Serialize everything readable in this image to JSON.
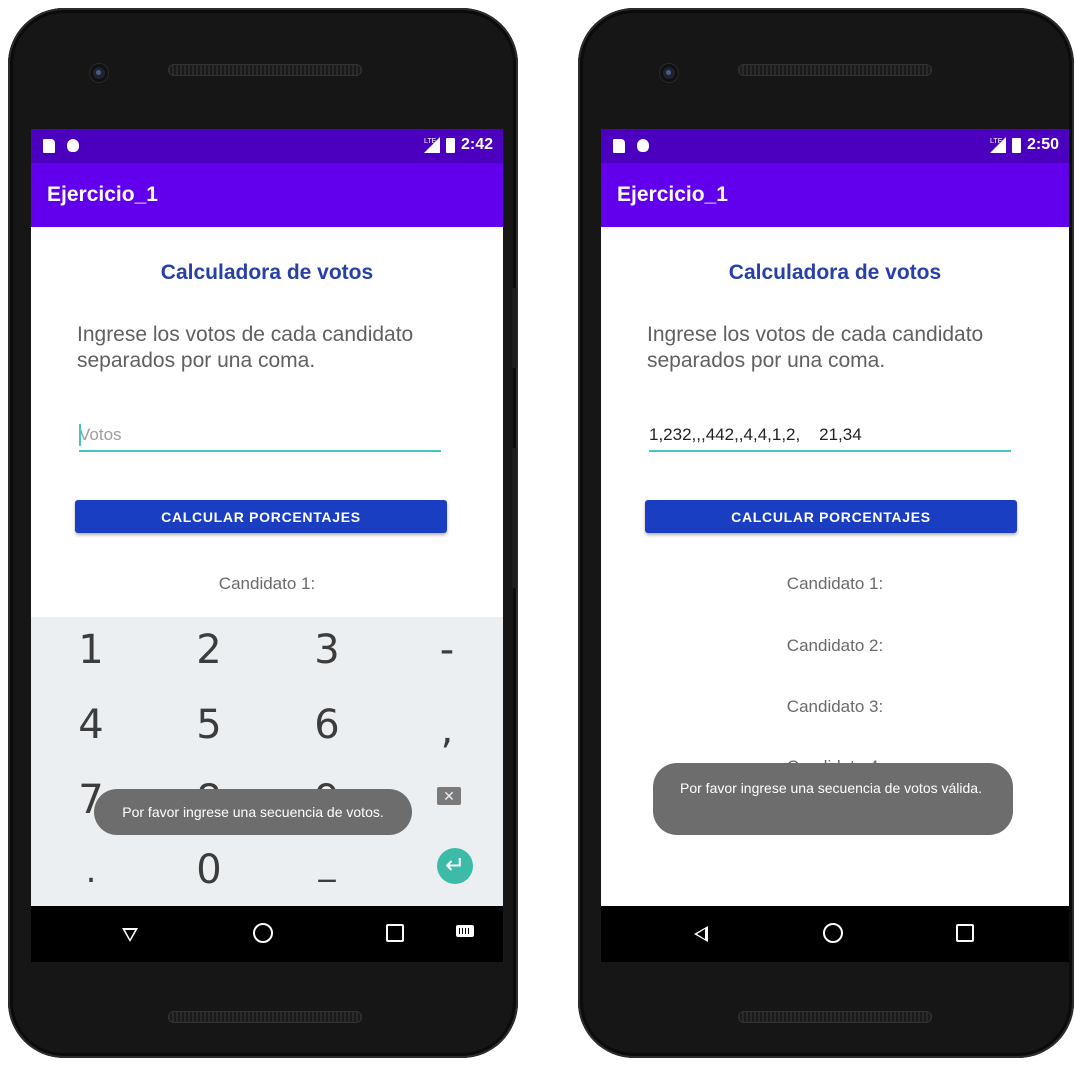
{
  "screens": [
    {
      "status_time": "2:42",
      "status_lte": "LTE",
      "app_title": "Ejercicio_1",
      "heading": "Calculadora de votos",
      "instruction": "Ingrese los votos de cada candidato separados por una coma.",
      "votes_input": {
        "value": "",
        "placeholder": "Votos"
      },
      "button_label": "CALCULAR PORCENTAJES",
      "candidates": [
        "Candidato 1:"
      ],
      "keyboard": {
        "row1": [
          "1",
          "2",
          "3",
          "-"
        ],
        "row2": [
          "4",
          "5",
          "6",
          ","
        ],
        "row3": [
          "7",
          "8",
          "9"
        ],
        "row4": [
          ".",
          "0",
          "_"
        ]
      },
      "toast": "Por favor ingrese una secuencia de votos."
    },
    {
      "status_time": "2:50",
      "status_lte": "LTE",
      "app_title": "Ejercicio_1",
      "heading": "Calculadora de votos",
      "instruction": "Ingrese los votos de cada candidato separados por una coma.",
      "votes_input": {
        "value": "1,232,,,442,,4,4,1,2,    21,34",
        "placeholder": "Votos"
      },
      "button_label": "CALCULAR PORCENTAJES",
      "candidates": [
        "Candidato 1:",
        "Candidato 2:",
        "Candidato 3:",
        "Candidato 4:"
      ],
      "toast": "Por favor ingrese una secuencia de votos válida."
    }
  ],
  "icons": {
    "status_left": [
      "sd-card-icon",
      "android-debug-icon"
    ],
    "status_right": [
      "signal-icon",
      "battery-icon"
    ],
    "nav_left_screen": [
      "back-down-icon",
      "home-icon",
      "recents-icon",
      "keyboard-switch-icon"
    ],
    "nav_right_screen": [
      "back-icon",
      "home-icon",
      "recents-icon"
    ]
  },
  "colors": {
    "status_bar": "#4b00bf",
    "app_bar": "#6200ee",
    "heading": "#2740a9",
    "button": "#1a3ec2",
    "input_underline": "#3fc7bd",
    "toast": "#6d6d6d",
    "keyboard_bg": "#eceff1",
    "enter_key": "#3dbba9"
  }
}
